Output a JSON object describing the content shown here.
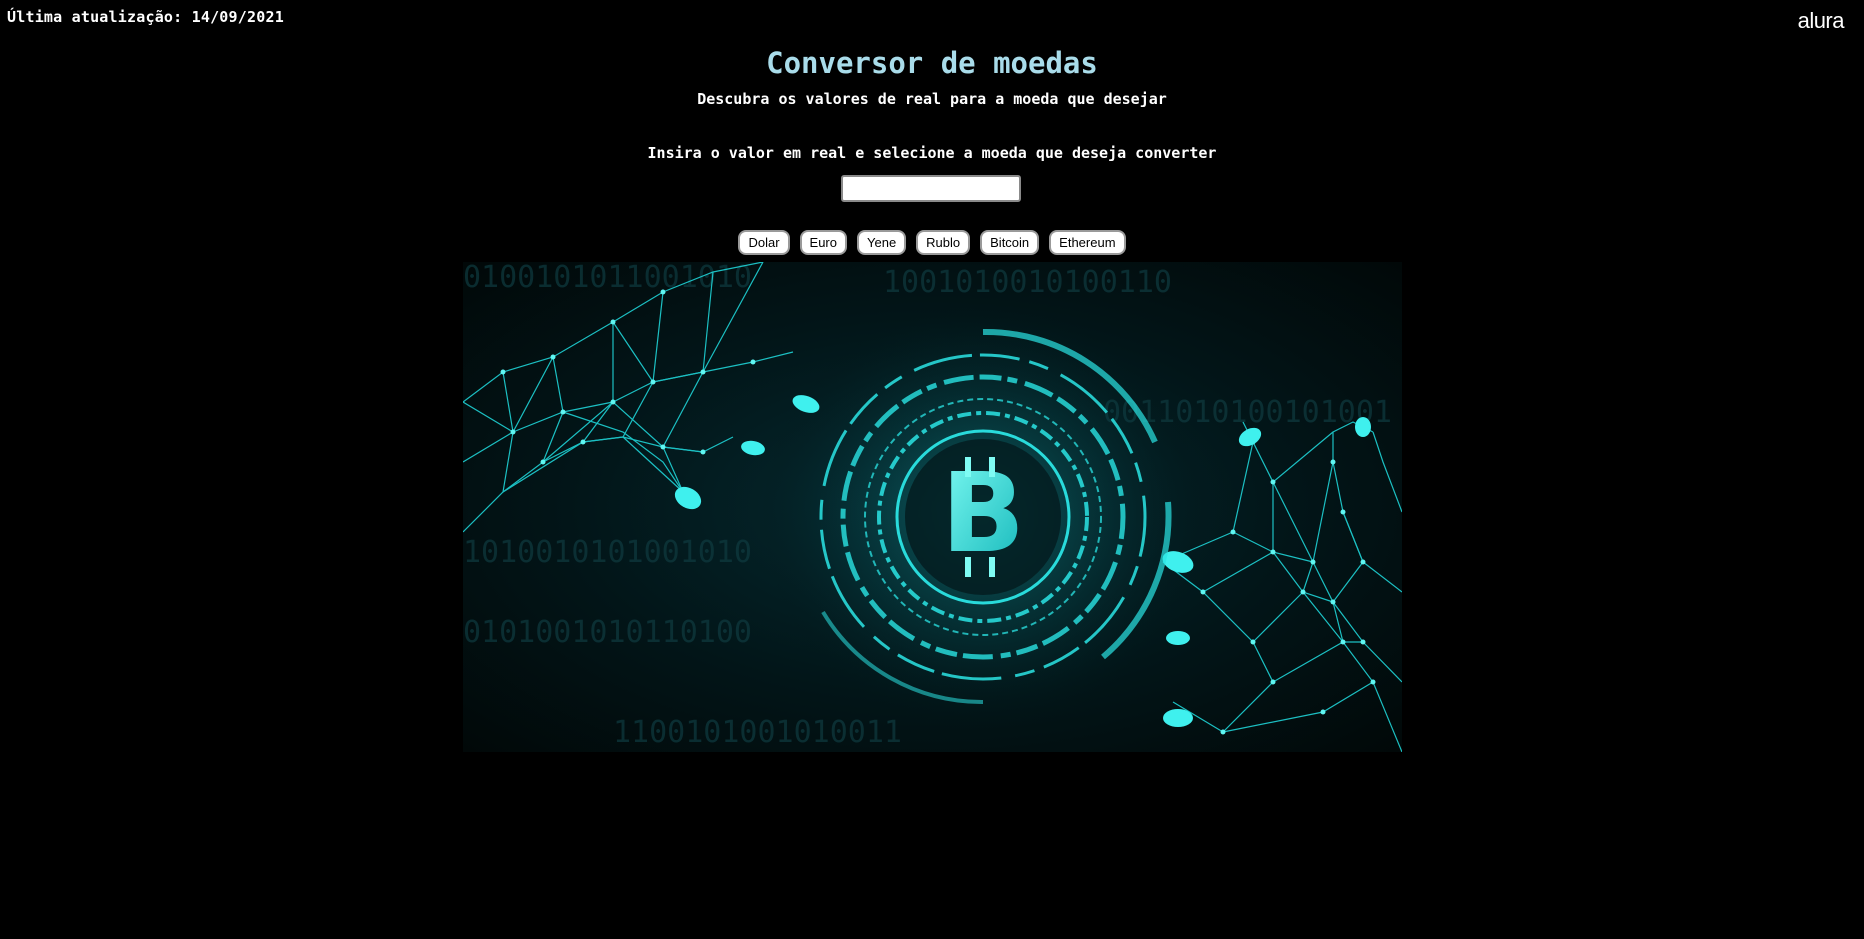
{
  "header": {
    "last_update": "Última atualização: 14/09/2021",
    "logo_text": "alura"
  },
  "main": {
    "title": "Conversor de moedas",
    "subtitle": "Descubra os valores de real para a moeda que desejar",
    "instruction": "Insira o valor em real e selecione a moeda que deseja converter",
    "input": {
      "value": "",
      "placeholder": ""
    },
    "currencies": [
      "Dolar",
      "Euro",
      "Yene",
      "Rublo",
      "Bitcoin",
      "Ethereum"
    ]
  },
  "hero": {
    "icon": "bitcoin-icon",
    "symbol": "B",
    "binary_rows": [
      "0100101011001010",
      "1001010010100110",
      "0011010100101001",
      "1010010101001010",
      "0101001010110100",
      "1100101001010011"
    ]
  },
  "colors": {
    "background": "#000000",
    "title": "#a9dcea",
    "accent": "#1fe0e0"
  }
}
